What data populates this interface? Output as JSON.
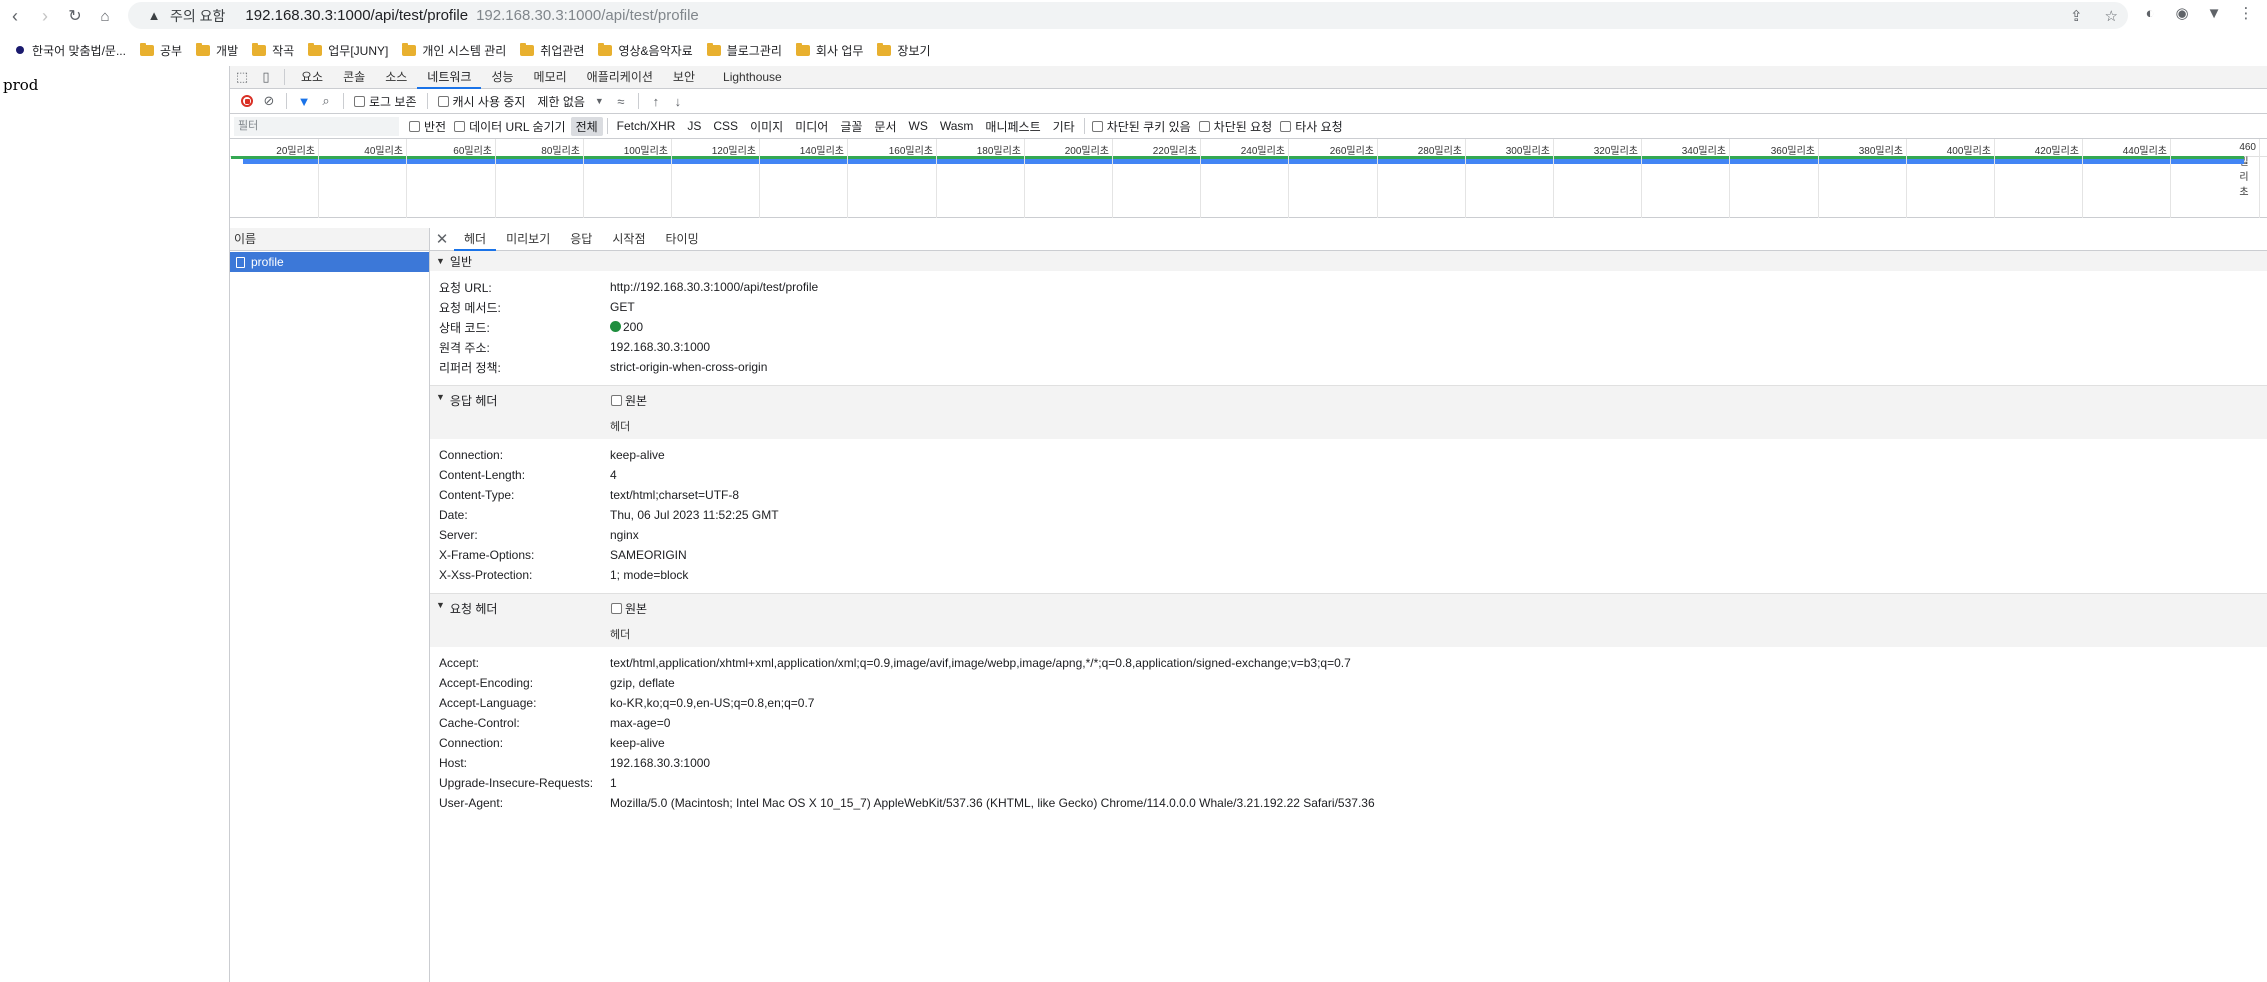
{
  "browser": {
    "security_label": "주의 요함",
    "url": "192.168.30.3:1000/api/test/profile",
    "url_suggestion": "192.168.30.3:1000/api/test/profile"
  },
  "bookmarks": [
    {
      "label": "한국어 맞춤법/문...",
      "icon": "site-icon"
    },
    {
      "label": "공부",
      "icon": "folder-icon"
    },
    {
      "label": "개발",
      "icon": "folder-icon"
    },
    {
      "label": "작곡",
      "icon": "folder-icon"
    },
    {
      "label": "업무[JUNY]",
      "icon": "folder-icon"
    },
    {
      "label": "개인 시스템 관리",
      "icon": "folder-icon"
    },
    {
      "label": "취업관련",
      "icon": "folder-icon"
    },
    {
      "label": "영상&음악자료",
      "icon": "folder-icon"
    },
    {
      "label": "블로그관리",
      "icon": "folder-icon"
    },
    {
      "label": "회사 업무",
      "icon": "folder-icon"
    },
    {
      "label": "장보기",
      "icon": "folder-icon"
    }
  ],
  "page": {
    "body_text": "prod"
  },
  "devtools": {
    "tabs": [
      "요소",
      "콘솔",
      "소스",
      "네트워크",
      "성능",
      "메모리",
      "애플리케이션",
      "보안",
      "Lighthouse"
    ],
    "active_tab": "네트워크",
    "toolbar": {
      "preserve_log": "로그 보존",
      "disable_cache": "캐시 사용 중지",
      "throttling": "제한 없음"
    },
    "filter": {
      "placeholder": "필터",
      "invert": "반전",
      "hide_data_urls": "데이터 URL 숨기기",
      "types": [
        "전체",
        "Fetch/XHR",
        "JS",
        "CSS",
        "이미지",
        "미디어",
        "글꼴",
        "문서",
        "WS",
        "Wasm",
        "매니페스트",
        "기타"
      ],
      "active_type": "전체",
      "blocked_cookies": "차단된 쿠키 있음",
      "blocked_requests": "차단된 요청",
      "third_party": "타사 요청"
    },
    "timeline_ticks": [
      "20밀리초",
      "40밀리초",
      "60밀리초",
      "80밀리초",
      "100밀리초",
      "120밀리초",
      "140밀리초",
      "160밀리초",
      "180밀리초",
      "200밀리초",
      "220밀리초",
      "240밀리초",
      "260밀리초",
      "280밀리초",
      "300밀리초",
      "320밀리초",
      "340밀리초",
      "360밀리초",
      "380밀리초",
      "400밀리초",
      "420밀리초",
      "440밀리초",
      "460밀리초"
    ],
    "name_column": "이름",
    "requests": [
      {
        "name": "profile"
      }
    ],
    "detail_tabs": [
      "헤더",
      "미리보기",
      "응답",
      "시작점",
      "타이밍"
    ],
    "active_detail_tab": "헤더",
    "general": {
      "title": "일반",
      "rows": [
        {
          "key": "요청 URL:",
          "value": "http://192.168.30.3:1000/api/test/profile"
        },
        {
          "key": "요청 메서드:",
          "value": "GET"
        },
        {
          "key": "상태 코드:",
          "value": "200"
        },
        {
          "key": "원격 주소:",
          "value": "192.168.30.3:1000"
        },
        {
          "key": "리퍼러 정책:",
          "value": "strict-origin-when-cross-origin"
        }
      ]
    },
    "response_headers": {
      "title": "응답 헤더",
      "raw_label": "원본",
      "sub_label": "헤더",
      "rows": [
        {
          "key": "Connection:",
          "value": "keep-alive"
        },
        {
          "key": "Content-Length:",
          "value": "4"
        },
        {
          "key": "Content-Type:",
          "value": "text/html;charset=UTF-8"
        },
        {
          "key": "Date:",
          "value": "Thu, 06 Jul 2023 11:52:25 GMT"
        },
        {
          "key": "Server:",
          "value": "nginx"
        },
        {
          "key": "X-Frame-Options:",
          "value": "SAMEORIGIN"
        },
        {
          "key": "X-Xss-Protection:",
          "value": "1; mode=block"
        }
      ]
    },
    "request_headers": {
      "title": "요청 헤더",
      "raw_label": "원본",
      "sub_label": "헤더",
      "rows": [
        {
          "key": "Accept:",
          "value": "text/html,application/xhtml+xml,application/xml;q=0.9,image/avif,image/webp,image/apng,*/*;q=0.8,application/signed-exchange;v=b3;q=0.7"
        },
        {
          "key": "Accept-Encoding:",
          "value": "gzip, deflate"
        },
        {
          "key": "Accept-Language:",
          "value": "ko-KR,ko;q=0.9,en-US;q=0.8,en;q=0.7"
        },
        {
          "key": "Cache-Control:",
          "value": "max-age=0"
        },
        {
          "key": "Connection:",
          "value": "keep-alive"
        },
        {
          "key": "Host:",
          "value": "192.168.30.3:1000"
        },
        {
          "key": "Upgrade-Insecure-Requests:",
          "value": "1"
        },
        {
          "key": "User-Agent:",
          "value": "Mozilla/5.0 (Macintosh; Intel Mac OS X 10_15_7) AppleWebKit/537.36 (KHTML, like Gecko) Chrome/114.0.0.0 Whale/3.21.192.22 Safari/537.36"
        }
      ]
    }
  },
  "colors": {
    "accent": "#1a73e8",
    "selected_row": "#3c78d8",
    "status_ok": "#1e8e3e",
    "record": "#d93025",
    "waterfall_green": "#34a853",
    "waterfall_blue": "#4285f4"
  }
}
